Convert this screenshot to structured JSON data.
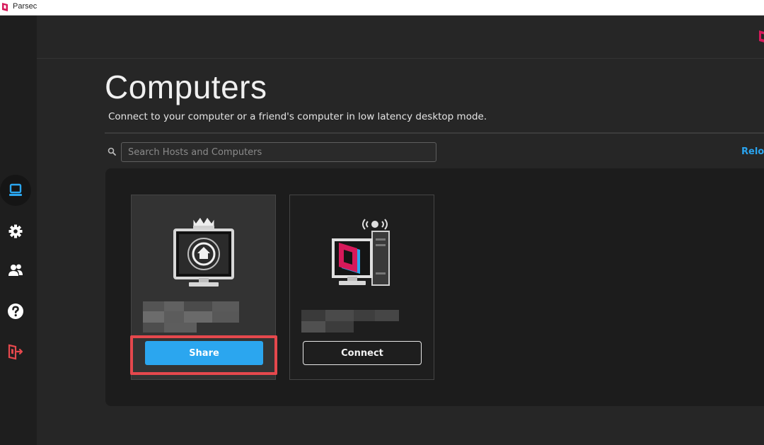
{
  "window": {
    "title": "Parsec",
    "brand_color": "#d6195a"
  },
  "sidebar": {
    "items": [
      {
        "name": "computers",
        "icon": "monitor-icon",
        "active": true,
        "color": "#2ba6ef"
      },
      {
        "name": "settings",
        "icon": "gear-icon",
        "active": false
      },
      {
        "name": "friends",
        "icon": "users-icon",
        "active": false
      },
      {
        "name": "help",
        "icon": "help-icon",
        "active": false
      },
      {
        "name": "logout",
        "icon": "logout-icon",
        "active": false,
        "color": "#e5484d"
      }
    ]
  },
  "main": {
    "title": "Computers",
    "subtitle": "Connect to your computer or a friend's computer in low latency desktop mode.",
    "search": {
      "placeholder": "Search Hosts and Computers",
      "value": ""
    },
    "reload_label": "Reloa",
    "accent_color": "#2ba6ef",
    "computers": [
      {
        "type": "host",
        "icon": "home-monitor-icon",
        "owner_badge": "crown-icon",
        "button_label": "Share",
        "highlighted": true
      },
      {
        "type": "friend",
        "icon": "parsec-computer-icon",
        "button_label": "Connect",
        "highlighted": false
      }
    ]
  }
}
